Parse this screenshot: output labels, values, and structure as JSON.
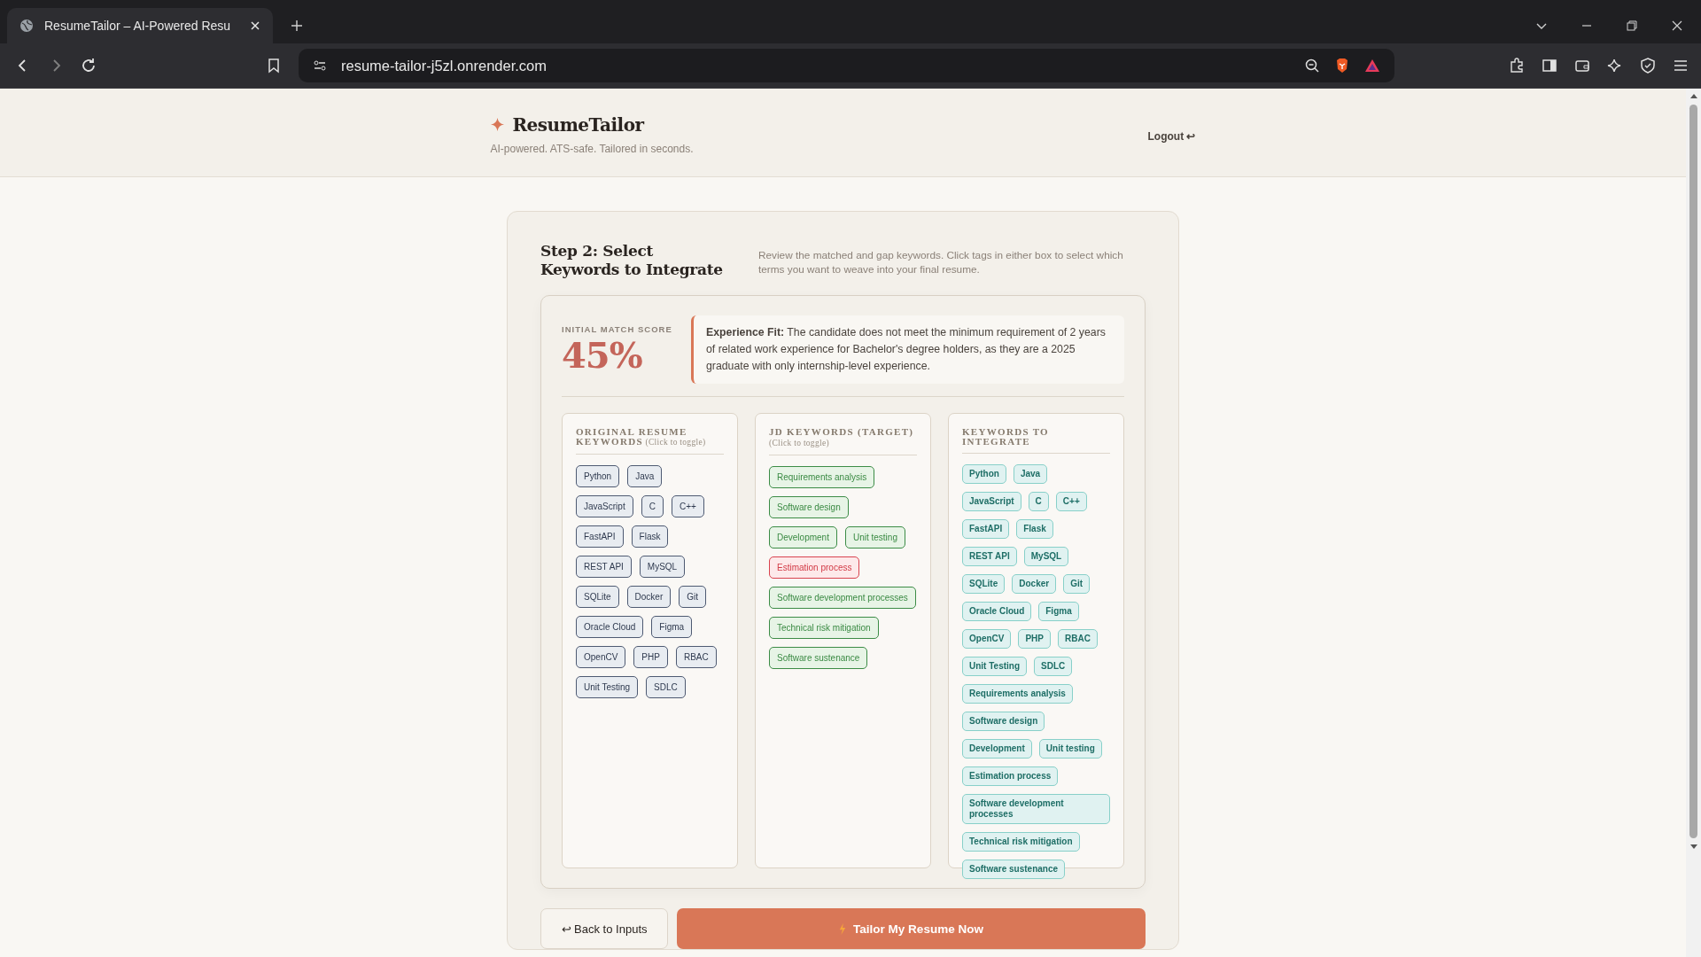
{
  "browser": {
    "tab_title": "ResumeTailor – AI-Powered Resu",
    "url": "resume-tailor-j5zl.onrender.com"
  },
  "header": {
    "title": "ResumeTailor",
    "tagline": "AI-powered. ATS-safe. Tailored in seconds.",
    "logout": "Logout ↩"
  },
  "step": {
    "title": "Step 2: Select Keywords to Integrate",
    "description": "Review the matched and gap keywords. Click tags in either box to select which terms you want to weave into your final resume."
  },
  "score": {
    "label": "INITIAL MATCH SCORE",
    "value": "45%"
  },
  "fit": {
    "text": "**Experience Fit:** The candidate does not meet the minimum requirement of 2 years of related work experience for Bachelor's degree holders, as they are a 2025 graduate with only internship-level experience."
  },
  "columns": [
    {
      "title": "ORIGINAL RESUME KEYWORDS",
      "hint": "(Click to toggle)",
      "tags": [
        {
          "label": "Python",
          "kind": "original"
        },
        {
          "label": "Java",
          "kind": "original"
        },
        {
          "label": "JavaScript",
          "kind": "original"
        },
        {
          "label": "C",
          "kind": "original"
        },
        {
          "label": "C++",
          "kind": "original"
        },
        {
          "label": "FastAPI",
          "kind": "original"
        },
        {
          "label": "Flask",
          "kind": "original"
        },
        {
          "label": "REST API",
          "kind": "original"
        },
        {
          "label": "MySQL",
          "kind": "original"
        },
        {
          "label": "SQLite",
          "kind": "original"
        },
        {
          "label": "Docker",
          "kind": "original"
        },
        {
          "label": "Git",
          "kind": "original"
        },
        {
          "label": "Oracle Cloud",
          "kind": "original"
        },
        {
          "label": "Figma",
          "kind": "original"
        },
        {
          "label": "OpenCV",
          "kind": "original"
        },
        {
          "label": "PHP",
          "kind": "original"
        },
        {
          "label": "RBAC",
          "kind": "original"
        },
        {
          "label": "Unit Testing",
          "kind": "original"
        },
        {
          "label": "SDLC",
          "kind": "original"
        }
      ]
    },
    {
      "title": "JD KEYWORDS (TARGET)",
      "hint": "(Click to toggle)",
      "tags": [
        {
          "label": "Requirements analysis",
          "kind": "matched"
        },
        {
          "label": "Software design",
          "kind": "matched"
        },
        {
          "label": "Development",
          "kind": "matched"
        },
        {
          "label": "Unit testing",
          "kind": "matched"
        },
        {
          "label": "Estimation process",
          "kind": "gap"
        },
        {
          "label": "Software development processes",
          "kind": "matched"
        },
        {
          "label": "Technical risk mitigation",
          "kind": "matched"
        },
        {
          "label": "Software sustenance",
          "kind": "matched"
        }
      ]
    },
    {
      "title": "KEYWORDS TO INTEGRATE",
      "tags": [
        {
          "label": "Python",
          "kind": "integrate"
        },
        {
          "label": "Java",
          "kind": "integrate"
        },
        {
          "label": "JavaScript",
          "kind": "integrate"
        },
        {
          "label": "C",
          "kind": "integrate"
        },
        {
          "label": "C++",
          "kind": "integrate"
        },
        {
          "label": "FastAPI",
          "kind": "integrate"
        },
        {
          "label": "Flask",
          "kind": "integrate"
        },
        {
          "label": "REST API",
          "kind": "integrate"
        },
        {
          "label": "MySQL",
          "kind": "integrate"
        },
        {
          "label": "SQLite",
          "kind": "integrate"
        },
        {
          "label": "Docker",
          "kind": "integrate"
        },
        {
          "label": "Git",
          "kind": "integrate"
        },
        {
          "label": "Oracle Cloud",
          "kind": "integrate"
        },
        {
          "label": "Figma",
          "kind": "integrate"
        },
        {
          "label": "OpenCV",
          "kind": "integrate"
        },
        {
          "label": "PHP",
          "kind": "integrate"
        },
        {
          "label": "RBAC",
          "kind": "integrate"
        },
        {
          "label": "Unit Testing",
          "kind": "integrate"
        },
        {
          "label": "SDLC",
          "kind": "integrate"
        },
        {
          "label": "Requirements analysis",
          "kind": "integrate"
        },
        {
          "label": "Software design",
          "kind": "integrate"
        },
        {
          "label": "Development",
          "kind": "integrate"
        },
        {
          "label": "Unit testing",
          "kind": "integrate"
        },
        {
          "label": "Estimation process",
          "kind": "integrate"
        },
        {
          "label": "Software development processes",
          "kind": "integrate"
        },
        {
          "label": "Technical risk mitigation",
          "kind": "integrate"
        },
        {
          "label": "Software sustenance",
          "kind": "integrate"
        }
      ]
    }
  ],
  "buttons": {
    "back": "↩ Back to Inputs",
    "tailor": "Tailor My Resume Now"
  }
}
